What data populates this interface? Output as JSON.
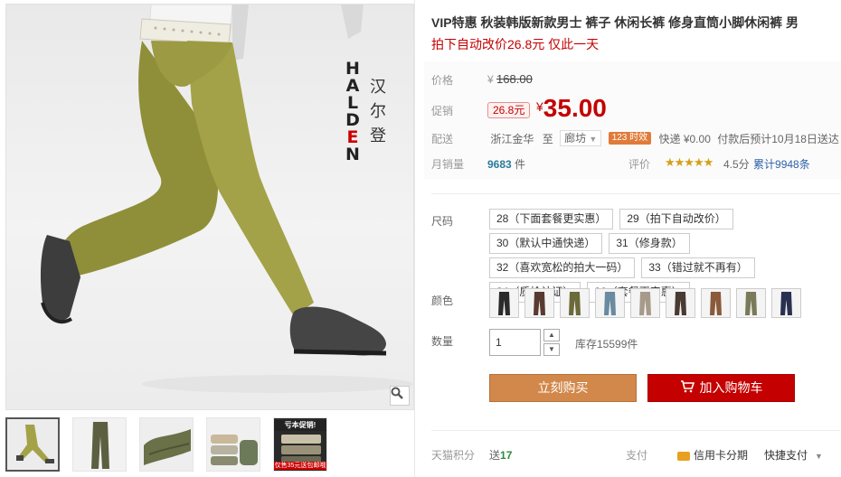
{
  "gallery": {
    "brand_letters": [
      "H",
      "A",
      "L",
      "D",
      "E",
      "N"
    ],
    "brand_cn": [
      "汉",
      "尔",
      "登"
    ],
    "thumb_promo_title": "亏本促销!",
    "thumb_promo_footer": "仅售35元送包邮哦"
  },
  "product": {
    "title": "VIP特惠 秋装韩版新款男士 裤子 休闲长裤 修身直筒小脚休闲裤 男",
    "subtitle": "拍下自动改价26.8元 仅此一天"
  },
  "price": {
    "label": "价格",
    "original_currency": "¥",
    "original": "168.00",
    "promo_label": "促销",
    "promo_tag": "26.8元",
    "promo_currency": "¥",
    "promo": "35.00"
  },
  "shipping": {
    "label": "配送",
    "from": "浙江金华",
    "to_word": "至",
    "city": "廊坊",
    "time_badge": "123 时效",
    "fee": "快递 ¥0.00",
    "eta": "付款后预计10月18日送达"
  },
  "sales": {
    "label": "月销量",
    "count": "9683",
    "unit": "件",
    "rating_label": "评价",
    "stars": "★★★★★",
    "rating": "4.5分",
    "reviews_prefix": "累计",
    "reviews": "9948条"
  },
  "size": {
    "label": "尺码",
    "options": [
      "28（下面套餐更实惠）",
      "29（拍下自动改价）",
      "30（默认中通快递）",
      "31（修身款）",
      "32（喜欢宽松的拍大一码）",
      "33（错过就不再有）",
      "34（质检认证）",
      "36（套餐更实惠）"
    ]
  },
  "color": {
    "label": "颜色",
    "swatches": [
      "#2b2b2b",
      "#5a3a30",
      "#6b6a3a",
      "#6a8aa0",
      "#a89a8a",
      "#4a3a34",
      "#8a5a3a",
      "#7a7a5a",
      "#2a3150"
    ]
  },
  "quantity": {
    "label": "数量",
    "value": "1",
    "stock": "库存15599件"
  },
  "actions": {
    "buy": "立刻购买",
    "cart": "加入购物车"
  },
  "footer": {
    "points_label": "天猫积分",
    "points_prefix": "送",
    "points": "17",
    "pay_label": "支付",
    "credit": "信用卡分期",
    "quick_pay": "快捷支付"
  },
  "colors": {
    "accent_red": "#c40000",
    "buy_orange": "#d2884a",
    "link_blue": "#2c61a8"
  }
}
